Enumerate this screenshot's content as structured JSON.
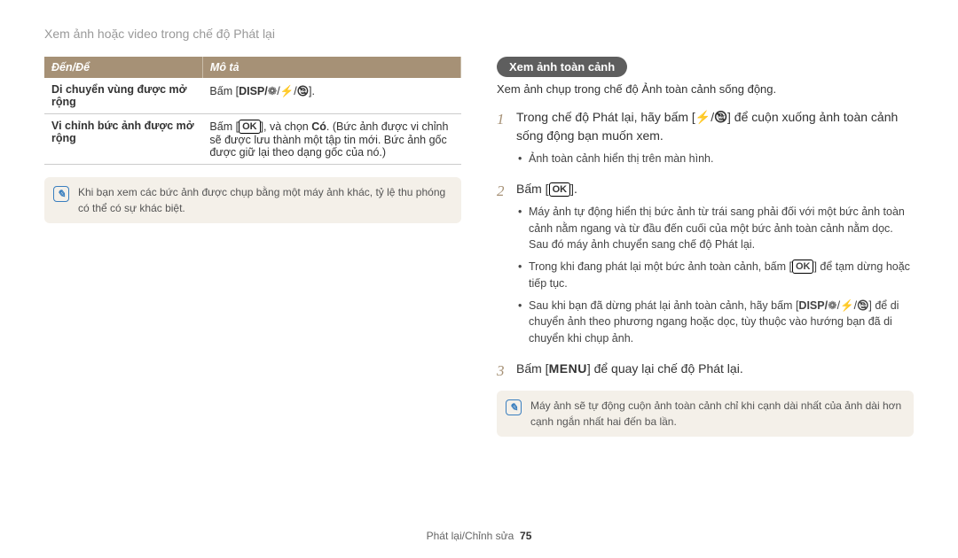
{
  "breadcrumb": "Xem ảnh hoặc video trong chế độ Phát lại",
  "table": {
    "head_to": "Đến/Để",
    "head_desc": "Mô tả",
    "row1_h": "Di chuyển vùng được mở rộng",
    "row1_d_prefix": "Bấm [",
    "row1_d_disp": "DISP/",
    "row1_d_suffix": "].",
    "row2_h": "Vi chỉnh bức ảnh được mở rộng",
    "row2_d_prefix": "Bấm [",
    "row2_d_mid": "], và chọn ",
    "row2_d_yes": "Có",
    "row2_d_rest": ". (Bức ảnh được vi chỉnh sẽ được lưu thành một tập tin mới. Bức ảnh gốc được giữ lại theo dạng gốc của nó.)"
  },
  "note_left": "Khi bạn xem các bức ảnh được chụp bằng một máy ảnh khác, tỷ lệ thu phóng có thể có sự khác biệt.",
  "section_title": "Xem ảnh toàn cảnh",
  "section_intro": "Xem ảnh chụp trong chế độ Ảnh toàn cảnh sống động.",
  "step1_a": "Trong chế độ Phát lại, hãy bấm [",
  "step1_b": "] để cuộn xuống ảnh toàn cảnh sống động bạn muốn xem.",
  "step1_sub1": "Ảnh toàn cảnh hiển thị trên màn hình.",
  "step2_a": "Bấm [",
  "step2_b": "].",
  "step2_sub1": "Máy ảnh tự động hiển thị bức ảnh từ trái sang phải đối với một bức ảnh toàn cảnh nằm ngang và từ đầu đến cuối của một bức ảnh toàn cảnh nằm dọc. Sau đó máy ảnh chuyển sang chế độ Phát lại.",
  "step2_sub2_a": "Trong khi đang phát lại một bức ảnh toàn cảnh, bấm [",
  "step2_sub2_b": "] để tạm dừng hoặc tiếp tục.",
  "step2_sub3_a": "Sau khi bạn đã dừng phát lại ảnh toàn cảnh, hãy bấm [",
  "step2_sub3_disp": "DISP/",
  "step2_sub3_b": "] để di chuyển ảnh theo phương ngang hoặc dọc, tùy thuộc vào hướng bạn đã di chuyển khi chụp ảnh.",
  "step3_a": "Bấm [",
  "step3_menu": "MENU",
  "step3_b": "] để quay lại chế độ Phát lại.",
  "note_right": "Máy ảnh sẽ tự động cuộn ảnh toàn cảnh chỉ khi cạnh dài nhất của ảnh dài hơn cạnh ngắn nhất hai đến ba lần.",
  "footer_section": "Phát lại/Chỉnh sửa",
  "footer_page": "75",
  "icons": {
    "flower": "❁",
    "flash": "⚡",
    "timer": "🕲",
    "note": "✎"
  }
}
